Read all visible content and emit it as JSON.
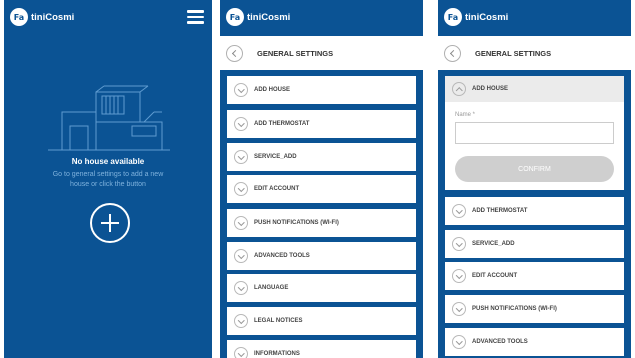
{
  "brand": {
    "badge": "Fa",
    "name": "tiniCosmi"
  },
  "panel1": {
    "empty_title": "No house available",
    "empty_text": "Go to general settings to add a new house or click the button"
  },
  "settings": {
    "title": "GENERAL SETTINGS",
    "items": [
      "ADD HOUSE",
      "ADD THERMOSTAT",
      "SERVICE_ADD",
      "EDIT ACCOUNT",
      "PUSH NOTIFICATIONS (WI-FI)",
      "ADVANCED TOOLS",
      "LANGUAGE",
      "LEGAL NOTICES",
      "INFORMATIONS"
    ]
  },
  "add_house_form": {
    "header": "ADD HOUSE",
    "name_label": "Name *",
    "name_value": "",
    "confirm_label": "CONFIRM"
  },
  "icons": {
    "menu": "hamburger-menu-icon",
    "add": "plus-circle-icon",
    "back": "chevron-left-icon",
    "expand": "chevron-down-icon",
    "collapse": "chevron-up-icon"
  },
  "colors": {
    "primary": "#0b5394",
    "muted_text": "#7fb2dd",
    "disabled_button": "#cfcfcf"
  }
}
